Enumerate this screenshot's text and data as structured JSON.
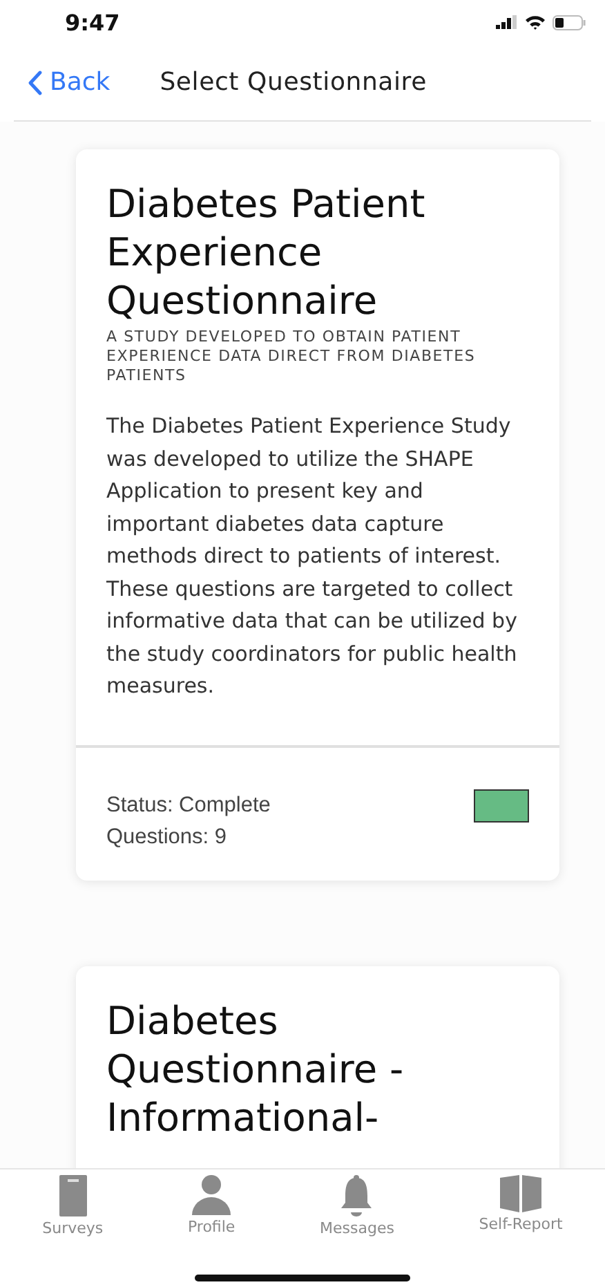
{
  "status_bar": {
    "time": "9:47"
  },
  "nav": {
    "back": "Back",
    "title": "Select Questionnaire"
  },
  "questionnaires": [
    {
      "title": "Diabetes Patient Experience Questionnaire",
      "subtitle": "A STUDY DEVELOPED TO OBTAIN PATIENT EXPERIENCE DATA DIRECT FROM DIABETES PATIENTS",
      "description": "The Diabetes Patient Experience Study was developed to utilize the SHAPE Application to present key and important diabetes data capture methods direct to patients of interest. These questions are targeted to collect informative data that can be utilized by the study coordinators for public health measures.",
      "status": "Status: Complete",
      "questions": "Questions: 9",
      "color": "#66bb84"
    },
    {
      "title": "Diabetes Questionnaire - Informational-"
    }
  ],
  "tab_bar": [
    {
      "kind": "clipboard",
      "label": "Surveys"
    },
    {
      "kind": "person",
      "label": "Profile"
    },
    {
      "kind": "bell",
      "label": "Messages"
    },
    {
      "kind": "book",
      "label": "Self-Report"
    }
  ]
}
